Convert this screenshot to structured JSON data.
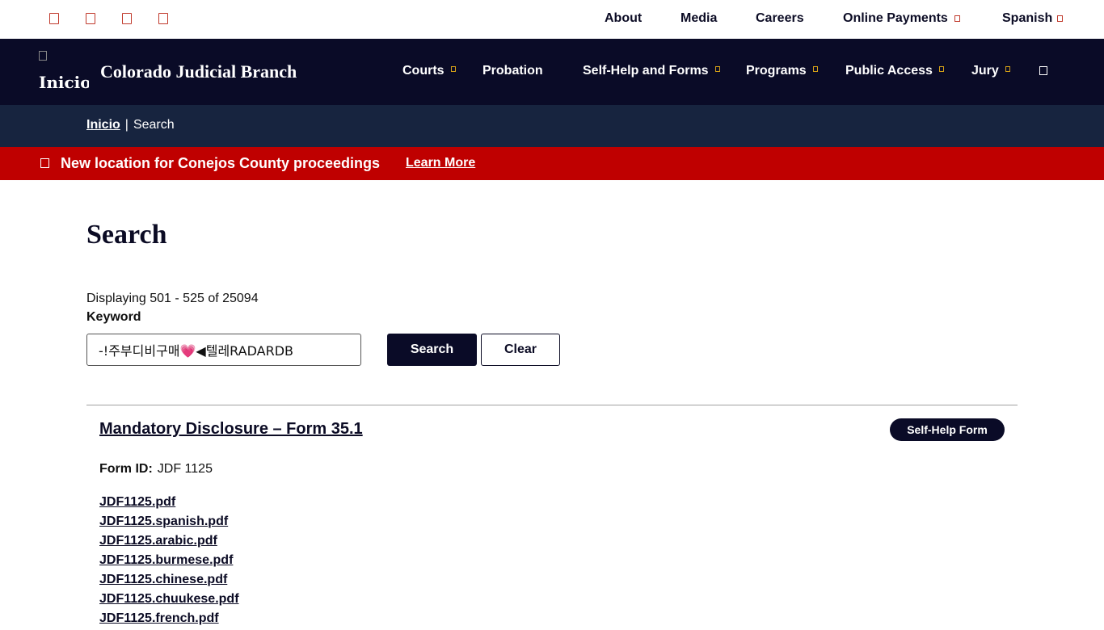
{
  "utility": {
    "social_icons": [
      "facebook-icon",
      "twitter-icon",
      "instagram-icon",
      "youtube-icon"
    ],
    "links": [
      {
        "label": "About"
      },
      {
        "label": "Media"
      },
      {
        "label": "Careers"
      },
      {
        "label": "Online Payments"
      },
      {
        "label": "Spanish"
      }
    ]
  },
  "header": {
    "logo_alt": "Inicio",
    "brand": "Colorado Judicial Branch",
    "nav": [
      {
        "label": "Courts"
      },
      {
        "label": "Probation"
      },
      {
        "label": "Self-Help and Forms"
      },
      {
        "label": "Programs"
      },
      {
        "label": "Public Access"
      },
      {
        "label": "Jury"
      }
    ]
  },
  "breadcrumb": {
    "home": "Inicio",
    "separator": "|",
    "current": "Search"
  },
  "alert": {
    "message": "New location for Conejos County proceedings",
    "link": "Learn More"
  },
  "main": {
    "title": "Search",
    "results_count": "Displaying 501 - 525 of 25094",
    "keyword_label": "Keyword",
    "keyword_value": "-!주부디비구매💗◀텔레RADARDB",
    "search_button": "Search",
    "clear_button": "Clear"
  },
  "result": {
    "title": "Mandatory Disclosure – Form 35.1",
    "badge": "Self-Help Form",
    "form_id_label": "Form ID:",
    "form_id_value": "JDF 1125",
    "files": [
      "JDF1125.pdf",
      "JDF1125.spanish.pdf",
      "JDF1125.arabic.pdf",
      "JDF1125.burmese.pdf",
      "JDF1125.chinese.pdf",
      "JDF1125.chuukese.pdf",
      "JDF1125.french.pdf"
    ]
  },
  "colors": {
    "navy": "#0a0b27",
    "breadcrumb_bg": "#17243f",
    "alert_red": "#bf0000",
    "accent_gold": "#d4a017"
  }
}
